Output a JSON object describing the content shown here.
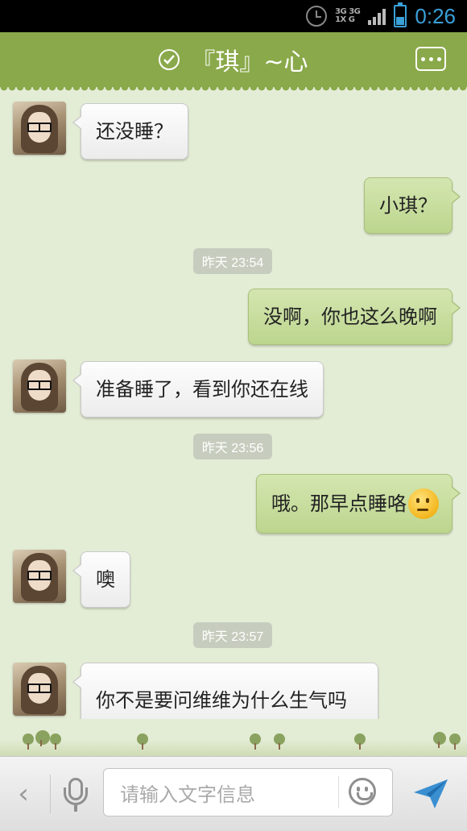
{
  "status_bar": {
    "network_label": "3G 3G 1X G",
    "time": "0:26"
  },
  "header": {
    "contact_name": "『琪』~心"
  },
  "messages": [
    {
      "side": "left",
      "text": "还没睡？"
    },
    {
      "side": "right",
      "text": "小琪？"
    },
    {
      "type": "time",
      "text": "昨天 23:54"
    },
    {
      "side": "right",
      "text": "没啊，你也这么晚啊"
    },
    {
      "side": "left",
      "text": "准备睡了，看到你还在线"
    },
    {
      "type": "time",
      "text": "昨天 23:56"
    },
    {
      "side": "right",
      "text": "哦。那早点睡咯",
      "emoji": "thinking-emoji"
    },
    {
      "side": "left",
      "text": "噢"
    },
    {
      "type": "time",
      "text": "昨天 23:57"
    },
    {
      "side": "left",
      "text": "你不是要问维维为什么生气吗"
    }
  ],
  "input_bar": {
    "placeholder": "请输入文字信息"
  },
  "colors": {
    "title_bar": "#8aa94a",
    "chat_background": "#e3ecd5",
    "right_bubble": "#c8de9e",
    "left_bubble": "#f6f6f6",
    "accent": "#3aa0d8"
  }
}
